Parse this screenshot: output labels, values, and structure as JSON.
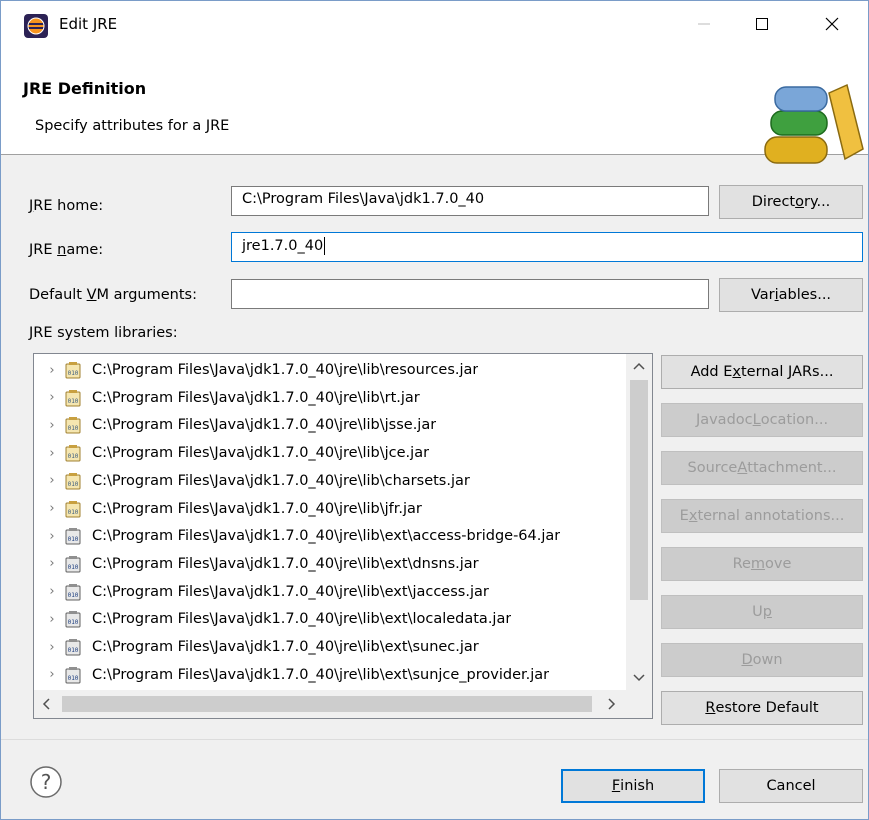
{
  "window": {
    "title": "Edit JRE",
    "controls": {
      "minimize": "—",
      "maximize": "☐",
      "close": "✕"
    }
  },
  "header": {
    "title": "JRE Definition",
    "description": "Specify attributes for a JRE"
  },
  "form": {
    "jre_home": {
      "label_pre": "",
      "label_key": "J",
      "label_post": "RE home:",
      "value": "C:\\Program Files\\Java\\jdk1.7.0_40"
    },
    "jre_name": {
      "label_pre": "JRE ",
      "label_key": "n",
      "label_post": "ame:",
      "value": "jre1.7.0_40"
    },
    "vm_args": {
      "label_pre": "Default ",
      "label_key": "V",
      "label_post": "M arguments:",
      "value": ""
    },
    "directory_button": {
      "pre": "Direct",
      "key": "o",
      "post": "ry..."
    },
    "variables_button": {
      "pre": "Var",
      "key": "i",
      "post": "ables..."
    },
    "libraries_label": "JRE system libraries:"
  },
  "libraries": [
    {
      "path": "C:\\Program Files\\Java\\jdk1.7.0_40\\jre\\lib\\resources.jar",
      "icon": "jar-source-icon"
    },
    {
      "path": "C:\\Program Files\\Java\\jdk1.7.0_40\\jre\\lib\\rt.jar",
      "icon": "jar-source-icon"
    },
    {
      "path": "C:\\Program Files\\Java\\jdk1.7.0_40\\jre\\lib\\jsse.jar",
      "icon": "jar-source-icon"
    },
    {
      "path": "C:\\Program Files\\Java\\jdk1.7.0_40\\jre\\lib\\jce.jar",
      "icon": "jar-source-icon"
    },
    {
      "path": "C:\\Program Files\\Java\\jdk1.7.0_40\\jre\\lib\\charsets.jar",
      "icon": "jar-source-icon"
    },
    {
      "path": "C:\\Program Files\\Java\\jdk1.7.0_40\\jre\\lib\\jfr.jar",
      "icon": "jar-source-icon"
    },
    {
      "path": "C:\\Program Files\\Java\\jdk1.7.0_40\\jre\\lib\\ext\\access-bridge-64.jar",
      "icon": "jar-binary-icon"
    },
    {
      "path": "C:\\Program Files\\Java\\jdk1.7.0_40\\jre\\lib\\ext\\dnsns.jar",
      "icon": "jar-binary-icon"
    },
    {
      "path": "C:\\Program Files\\Java\\jdk1.7.0_40\\jre\\lib\\ext\\jaccess.jar",
      "icon": "jar-binary-icon"
    },
    {
      "path": "C:\\Program Files\\Java\\jdk1.7.0_40\\jre\\lib\\ext\\localedata.jar",
      "icon": "jar-binary-icon"
    },
    {
      "path": "C:\\Program Files\\Java\\jdk1.7.0_40\\jre\\lib\\ext\\sunec.jar",
      "icon": "jar-binary-icon"
    },
    {
      "path": "C:\\Program Files\\Java\\jdk1.7.0_40\\jre\\lib\\ext\\sunjce_provider.jar",
      "icon": "jar-binary-icon"
    }
  ],
  "side_buttons": [
    {
      "pre": "Add E",
      "key": "x",
      "post": "ternal JARs...",
      "enabled": true
    },
    {
      "pre": "Javadoc ",
      "key": "L",
      "post": "ocation...",
      "enabled": false
    },
    {
      "pre": "Source ",
      "key": "A",
      "post": "ttachment...",
      "enabled": false
    },
    {
      "pre": "E",
      "key": "x",
      "post": "ternal annotations...",
      "enabled": false
    },
    {
      "pre": "Re",
      "key": "m",
      "post": "ove",
      "enabled": false
    },
    {
      "pre": "U",
      "key": "p",
      "post": "",
      "enabled": false
    },
    {
      "pre": "",
      "key": "D",
      "post": "own",
      "enabled": false
    },
    {
      "pre": "",
      "key": "R",
      "post": "estore Default",
      "enabled": true
    }
  ],
  "footer": {
    "finish": {
      "pre": "",
      "key": "F",
      "post": "inish"
    },
    "cancel": "Cancel"
  },
  "colors": {
    "accent": "#0078d7",
    "dialog_bg": "#f0f0f0",
    "disabled_text": "#9c9c9c"
  }
}
